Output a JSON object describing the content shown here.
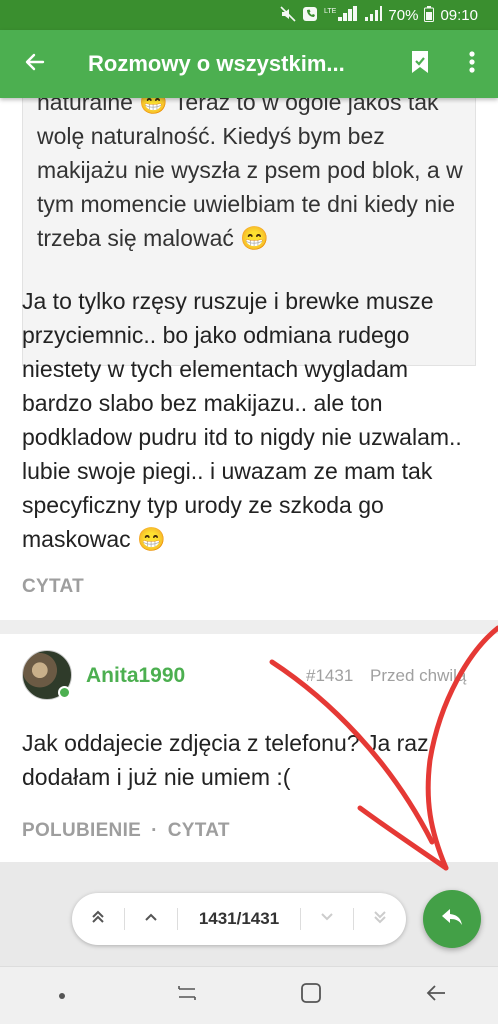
{
  "statusbar": {
    "battery": "70%",
    "time": "09:10",
    "network": "LTE"
  },
  "appbar": {
    "title": "Rozmowy o wszystkim...",
    "back_icon": "arrow-left-icon",
    "bookmark_icon": "bookmark-icon",
    "more_icon": "more-vert-icon"
  },
  "quote": {
    "lines": "naturalne 😁 Teraz to w ogóle jakoś tak wolę naturalność. Kiedyś bym bez makijażu nie wyszła z psem pod blok, a w tym momencie uwielbiam te dni kiedy nie trzeba się malować 😁"
  },
  "post1": {
    "text": "Ja to tylko rzęsy ruszuje i brewke musze przyciemnic.. bo jako odmiana rudego niestety w tych elementach wygladam bardzo slabo bez makijazu.. ale ton podkladow pudru itd to nigdy nie uzwalam.. lubie swoje piegi.. i uwazam ze mam tak specyficzny typ urody ze szkoda go maskowac 😁",
    "quote_action": "CYTAT"
  },
  "post2": {
    "username": "Anita1990",
    "number": "#1431",
    "time": "Przed chwilą",
    "text": "Jak oddajecie zdjęcia z telefonu? Ja raz dodałam i już nie umiem :(",
    "like_action": "POLUBIENIE",
    "separator": "·",
    "quote_action": "CYTAT"
  },
  "pager": {
    "count": "1431/1431"
  },
  "colors": {
    "accent": "#4caf50",
    "statusbar": "#3a8f2f",
    "annotation": "#e53935"
  }
}
